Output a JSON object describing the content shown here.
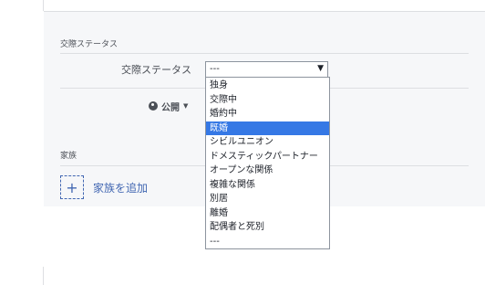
{
  "section": {
    "relationship_title": "交際ステータス",
    "family_title": "家族"
  },
  "relationship": {
    "label": "交際ステータス",
    "selected": "---",
    "options": [
      "独身",
      "交際中",
      "婚約中",
      "既婚",
      "シビルユニオン",
      "ドメスティックパートナー",
      "オープンな関係",
      "複雑な関係",
      "別居",
      "離婚",
      "配偶者と死別",
      "---"
    ],
    "highlighted_index": 3
  },
  "privacy": {
    "label": "公開"
  },
  "family": {
    "add_label": "家族を追加"
  },
  "colors": {
    "accent": "#4267b2",
    "highlight": "#3578e5",
    "panel_bg": "#f6f7f9"
  }
}
